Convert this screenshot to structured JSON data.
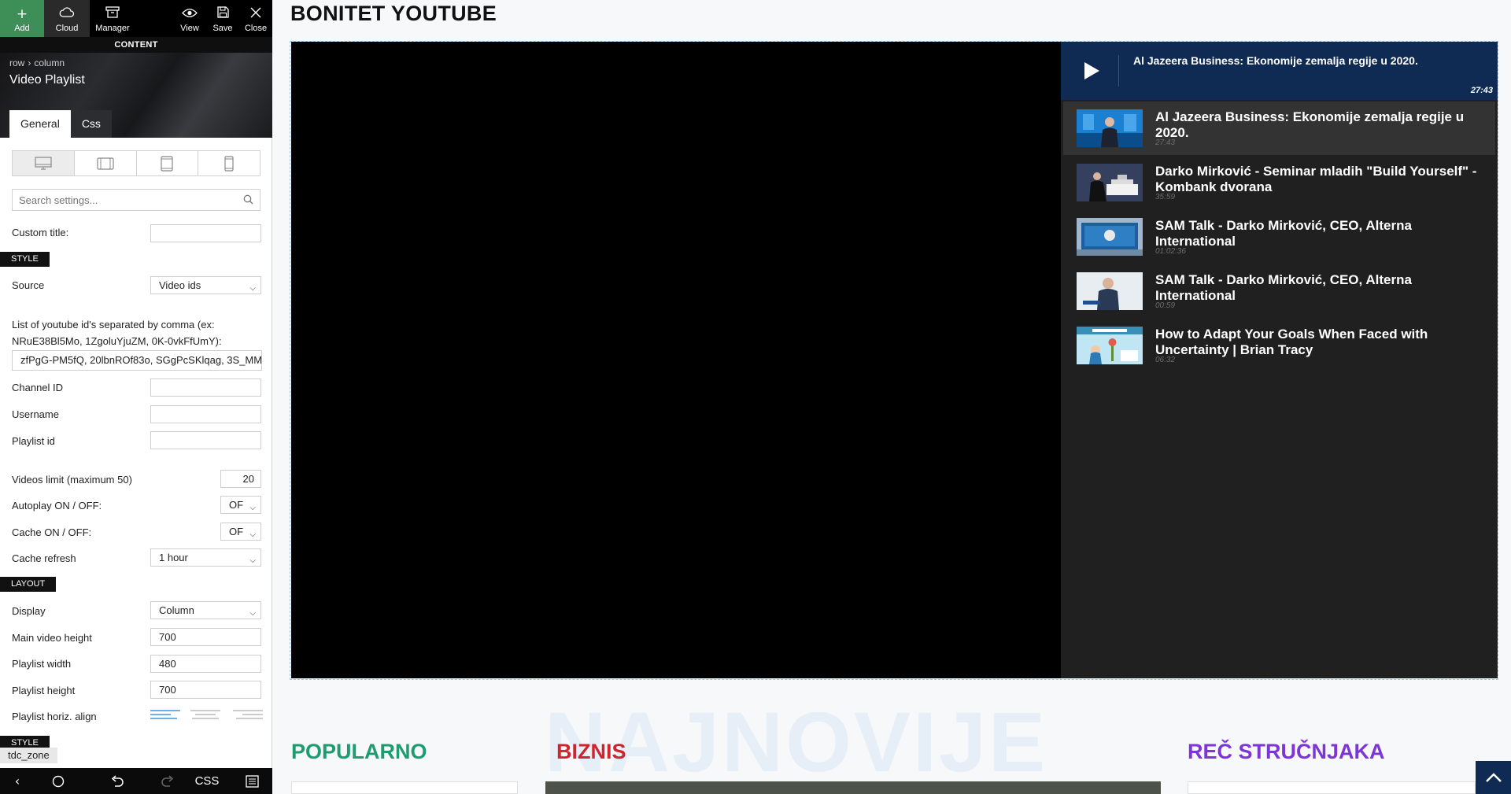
{
  "toolbar": {
    "add_label": "Add",
    "cloud_label": "Cloud",
    "manager_label": "Manager",
    "view_label": "View",
    "save_label": "Save",
    "close_label": "Close",
    "content_label": "CONTENT"
  },
  "breadcrumb": [
    "row",
    "column"
  ],
  "widget": {
    "name": "Video Playlist"
  },
  "tabs": [
    {
      "label": "General",
      "active": true
    },
    {
      "label": "Css",
      "active": false
    }
  ],
  "devices": [
    "desktop",
    "landscape-tablet",
    "portrait-tablet",
    "phone"
  ],
  "search": {
    "placeholder": "Search settings..."
  },
  "settings": {
    "custom_title_label": "Custom title:",
    "custom_title_value": "",
    "style_tag": "STYLE",
    "source_label": "Source",
    "source_value": "Video ids",
    "ids_label": "List of youtube id's separated by comma (ex: NRuE38Bl5Mo, 1ZgoluYjuZM, 0K-0vkFfUmY):",
    "ids_value": "zfPgG-PM5fQ, 20lbnROf83o, SGgPcSKlqag, 3S_MM",
    "channel_id_label": "Channel ID",
    "username_label": "Username",
    "playlist_id_label": "Playlist id",
    "videos_limit_label": "Videos limit (maximum 50)",
    "videos_limit_value": "20",
    "autoplay_label": "Autoplay ON / OFF:",
    "autoplay_value": "OF",
    "cache_label": "Cache ON / OFF:",
    "cache_value": "OF",
    "cache_refresh_label": "Cache refresh",
    "cache_refresh_value": "1 hour",
    "layout_tag": "LAYOUT",
    "display_label": "Display",
    "display_value": "Column",
    "main_video_height_label": "Main video height",
    "main_video_height_value": "700",
    "playlist_width_label": "Playlist width",
    "playlist_width_value": "480",
    "playlist_height_label": "Playlist height",
    "playlist_height_value": "700",
    "playlist_align_label": "Playlist horiz. align",
    "style_tag_2": "STYLE"
  },
  "zone_label": "tdc_zone",
  "bottom_bar": {
    "css_label": "CSS"
  },
  "page": {
    "title": "BONITET YOUTUBE",
    "now_playing": {
      "title": "Al Jazeera Business: Ekonomije zemalja regije u 2020.",
      "duration": "27:43"
    },
    "playlist": [
      {
        "title": "Al Jazeera Business: Ekonomije zemalja regije u 2020.",
        "duration": "27:43",
        "current": true
      },
      {
        "title": "Darko Mirković - Seminar mladih \"Build Yourself\" - Kombank dvorana",
        "duration": "35:59",
        "current": false
      },
      {
        "title": "SAM Talk - Darko Mirković, CEO, Alterna International",
        "duration": "01:02:36",
        "current": false
      },
      {
        "title": "SAM Talk - Darko Mirković, CEO, Alterna International",
        "duration": "00:59",
        "current": false
      },
      {
        "title": "How to Adapt Your Goals When Faced with Uncertainty | Brian Tracy",
        "duration": "06:32",
        "current": false
      }
    ],
    "background_word": "NAJNOVIJE",
    "sections": [
      "POPULARNO",
      "BIZNIS",
      "REČ STRUČNJAKA"
    ],
    "colors": {
      "popularno": "#1e9c6f",
      "biznis": "#d0252f",
      "rec": "#7d35d6",
      "playlist_header": "#0f2b53"
    }
  }
}
